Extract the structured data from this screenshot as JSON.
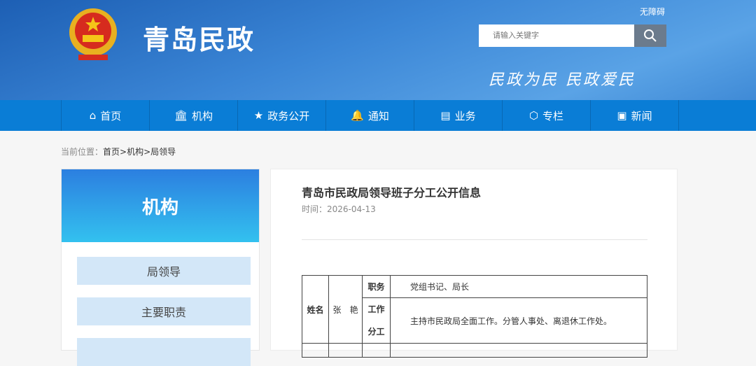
{
  "header": {
    "site_title": "青岛民政",
    "accessibility": "无障碍",
    "search_placeholder": "请输入关键字",
    "slogan": "民政为民  民政爱民"
  },
  "nav": [
    {
      "icon": "home-icon",
      "glyph": "⌂",
      "label": "首页"
    },
    {
      "icon": "institution-icon",
      "glyph": "🏛",
      "label": "机构"
    },
    {
      "icon": "star-icon",
      "glyph": "★",
      "label": "政务公开"
    },
    {
      "icon": "bell-icon",
      "glyph": "🔔",
      "label": "通知"
    },
    {
      "icon": "document-icon",
      "glyph": "▤",
      "label": "业务"
    },
    {
      "icon": "badge-icon",
      "glyph": "⬡",
      "label": "专栏"
    },
    {
      "icon": "news-icon",
      "glyph": "▣",
      "label": "新闻"
    }
  ],
  "breadcrumb": {
    "label": "当前位置：",
    "items": [
      "首页",
      ">",
      "机构",
      ">",
      "局领导"
    ]
  },
  "sidebar": {
    "title": "机构",
    "items": [
      "局领导",
      "主要职责",
      ""
    ]
  },
  "article": {
    "title": "青岛市民政局领导班子分工公开信息",
    "date": "时间：2026-04-13",
    "table": {
      "name_label": "姓名",
      "name": "张　艳",
      "position_label": "职务",
      "position": "党组书记、局长",
      "duty_label_1": "工作",
      "duty_label_2": "分工",
      "duty": "主持市民政局全面工作。分管人事处、离退休工作处。"
    }
  },
  "colors": {
    "nav": "#0a7dd6",
    "search_button": "#6b7b8d",
    "sidebar_item": "#d3e7f8"
  }
}
